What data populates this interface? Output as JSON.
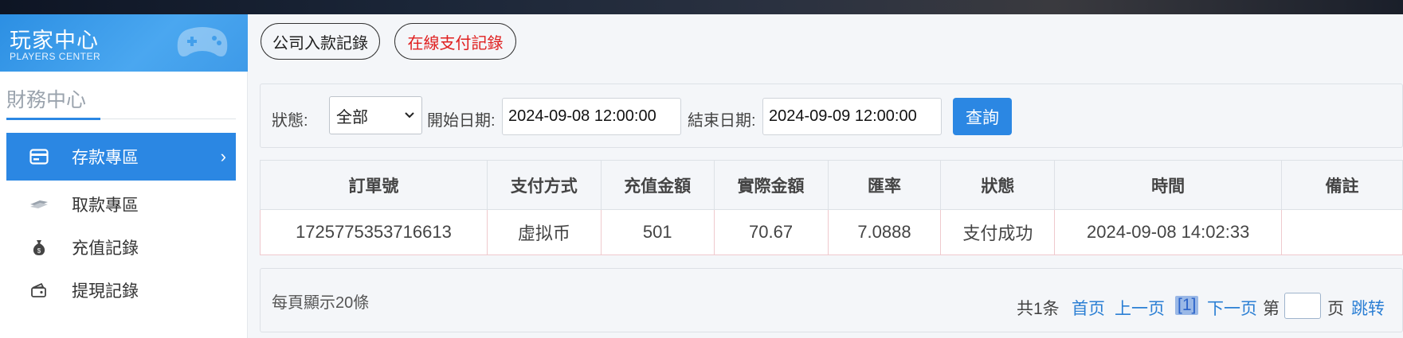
{
  "brand": {
    "title_zh": "玩家中心",
    "title_en": "PLAYERS CENTER"
  },
  "sidebar": {
    "section_title": "財務中心",
    "items": [
      {
        "label": "存款專區",
        "icon": "card-icon",
        "active": true
      },
      {
        "label": "取款專區",
        "icon": "cash-icon",
        "active": false
      },
      {
        "label": "充值記錄",
        "icon": "money-bag-icon",
        "active": false
      },
      {
        "label": "提現記錄",
        "icon": "wallet-icon",
        "active": false
      }
    ]
  },
  "tabs": [
    {
      "label": "公司入款記錄",
      "color": "#222222"
    },
    {
      "label": "在線支付記錄",
      "color": "#e02020"
    }
  ],
  "filter": {
    "status_label": "狀態:",
    "status_value": "全部",
    "start_label": "開始日期:",
    "start_value": "2024-09-08 12:00:00",
    "end_label": "結束日期:",
    "end_value": "2024-09-09 12:00:00",
    "query_label": "查詢"
  },
  "table": {
    "headers": [
      "訂單號",
      "支付方式",
      "充值金額",
      "實際金額",
      "匯率",
      "狀態",
      "時間",
      "備註"
    ],
    "rows": [
      [
        "1725775353716613",
        "虛拟币",
        "501",
        "70.67",
        "7.0888",
        "支付成功",
        "2024-09-08 14:02:33",
        ""
      ]
    ]
  },
  "footer": {
    "per_page": "每頁顯示20條",
    "total": "共1条",
    "first": "首页",
    "prev": "上一页",
    "current": "[1]",
    "next": "下一页",
    "goto_prefix": "第",
    "goto_suffix": "页",
    "jump": "跳转"
  },
  "colors": {
    "accent": "#2b87e3",
    "danger": "#e02020"
  }
}
